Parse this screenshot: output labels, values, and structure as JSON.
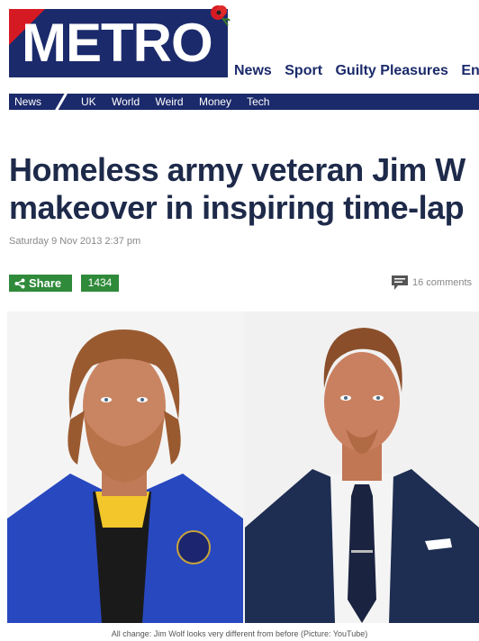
{
  "logo": {
    "text": "METRO"
  },
  "top_nav": {
    "items": [
      "News",
      "Sport",
      "Guilty Pleasures",
      "Enter"
    ]
  },
  "sub_nav": {
    "active": "News",
    "items": [
      "UK",
      "World",
      "Weird",
      "Money",
      "Tech"
    ]
  },
  "article": {
    "headline_line1": "Homeless army veteran Jim W",
    "headline_line2": "makeover in inspiring time-lap",
    "date": "Saturday 9 Nov 2013 2:37 pm",
    "share_label": "Share",
    "share_count": "1434",
    "comments": "16 comments",
    "caption": "All change: Jim Wolf looks very different from before (Picture: YouTube)"
  },
  "colors": {
    "brand_navy": "#1b2a6b",
    "brand_red": "#d51a23",
    "share_green": "#2f8a3a"
  }
}
